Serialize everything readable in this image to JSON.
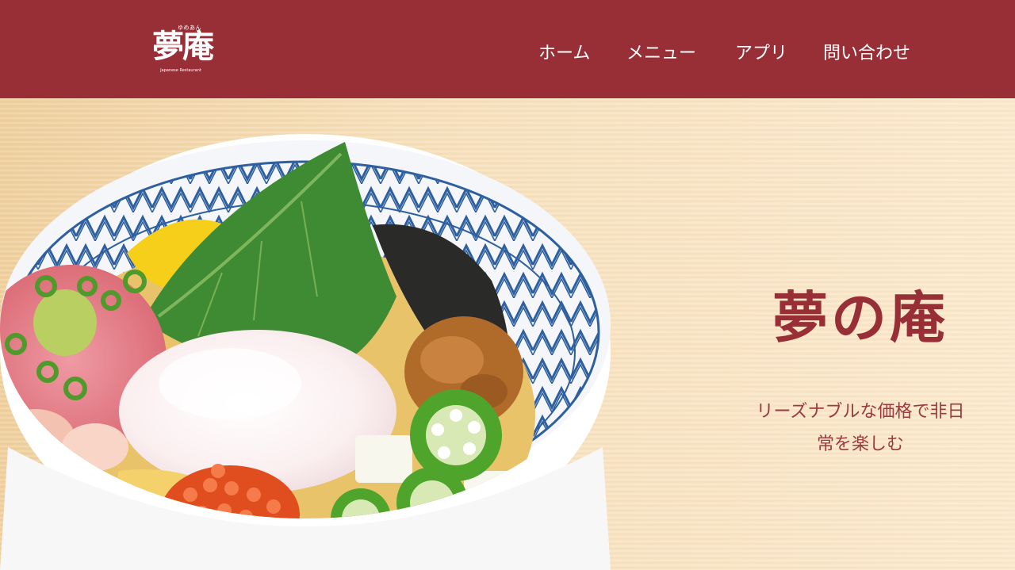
{
  "header": {
    "logo": {
      "ruby": "ゆめあん",
      "mark": "夢庵",
      "subtitle": "Japanese Restaurant"
    },
    "nav": [
      {
        "label": "ホーム"
      },
      {
        "label": "メニュー"
      },
      {
        "label": "アプリ"
      },
      {
        "label": "問い合わせ"
      }
    ]
  },
  "hero": {
    "title": "夢の庵",
    "subtitle_line1": "リーズナブルな価格で非日",
    "subtitle_line2": "常を楽しむ"
  },
  "colors": {
    "brand": "#982f37",
    "header_text": "#ffffff",
    "hero_background": "#f3dcb3"
  },
  "icons": {
    "logo": "yumean-logo",
    "hero_image": "donburi-bowl-illustration"
  }
}
